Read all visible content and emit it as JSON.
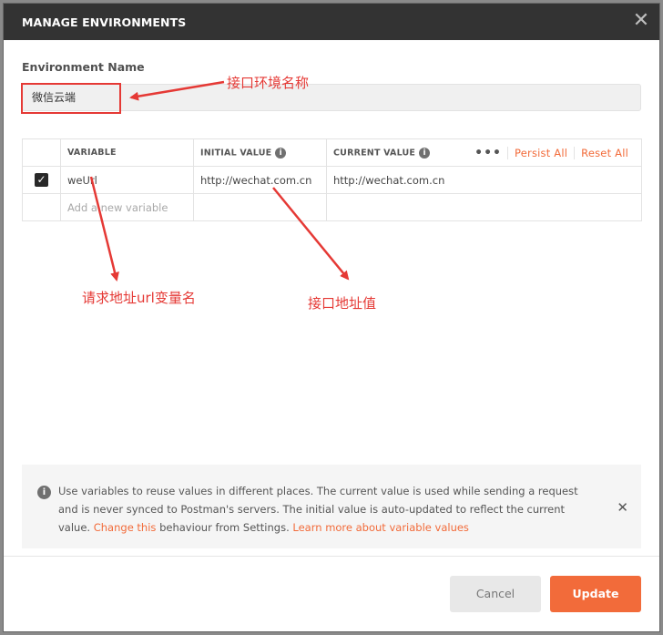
{
  "modal": {
    "title": "MANAGE ENVIRONMENTS",
    "close_icon": "close-icon"
  },
  "environment": {
    "label": "Environment Name",
    "value": "微信云端"
  },
  "table": {
    "headers": {
      "variable": "VARIABLE",
      "initial_value": "INITIAL VALUE",
      "current_value": "CURRENT VALUE",
      "more": "•••",
      "persist_all": "Persist All",
      "reset_all": "Reset All"
    },
    "rows": [
      {
        "checked": true,
        "variable": "weUrl",
        "initial_value": "http://wechat.com.cn",
        "current_value": "http://wechat.com.cn"
      }
    ],
    "new_row_placeholder": "Add a new variable"
  },
  "annotations": {
    "env_name": "接口环境名称",
    "var_name": "请求地址url变量名",
    "address": "接口地址值"
  },
  "info": {
    "text_1": "Use variables to reuse values in different places. The current value is used while sending a request and is never synced to Postman's servers. The initial value is auto-updated to reflect the current value.",
    "link_change": "Change this",
    "text_2": "behaviour from Settings.",
    "link_learn": "Learn more about variable values"
  },
  "footer": {
    "cancel_label": "Cancel",
    "update_label": "Update"
  },
  "colors": {
    "accent": "#f26b3a",
    "header_bg": "#333333",
    "annotation": "#e53935"
  }
}
